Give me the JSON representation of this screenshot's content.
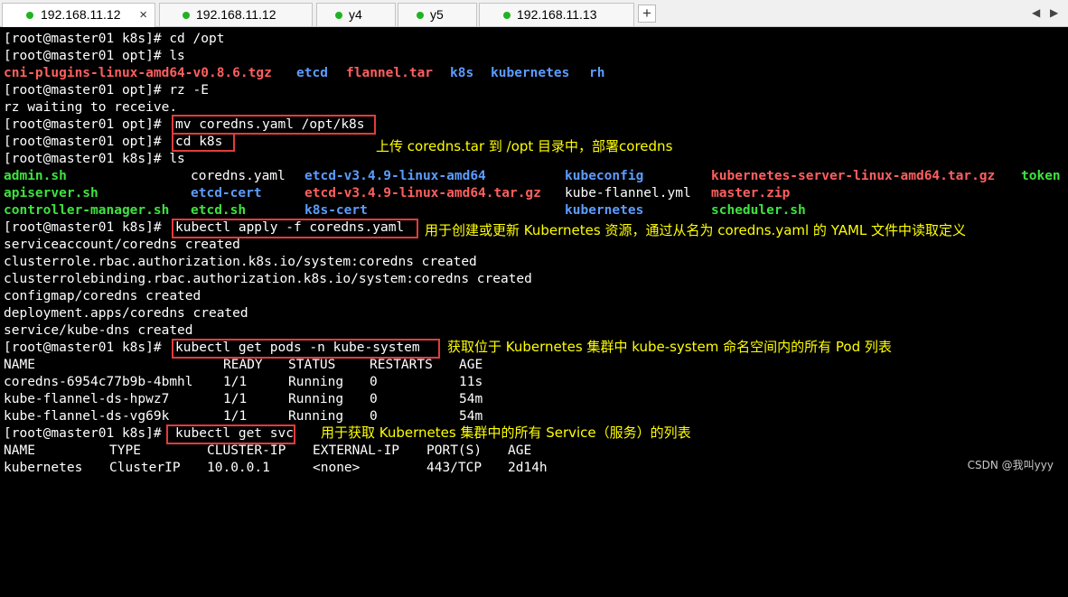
{
  "tabs": [
    {
      "label": "192.168.11.12",
      "active": true
    },
    {
      "label": "192.168.11.12",
      "active": false
    },
    {
      "label": "y4",
      "active": false
    },
    {
      "label": "y5",
      "active": false
    },
    {
      "label": "192.168.11.13",
      "active": false
    }
  ],
  "tabbar": {
    "close": "×",
    "add": "+",
    "prev": "◀",
    "next": "▶"
  },
  "terminal": {
    "l1": "[root@master01 k8s]# cd /opt",
    "l2": "[root@master01 opt]# ls",
    "l3": {
      "a": "cni-plugins-linux-amd64-v0.8.6.tgz",
      "b": "etcd",
      "c": "flannel.tar",
      "d": "k8s",
      "e": "kubernetes",
      "f": "rh"
    },
    "l4": "[root@master01 opt]# rz -E",
    "l5": "rz waiting to receive.",
    "l6": {
      "prompt": "[root@master01 opt]# ",
      "cmd": "mv coredns.yaml /opt/k8s"
    },
    "l7": {
      "prompt": "[root@master01 opt]# ",
      "cmd": "cd k8s"
    },
    "l8": "[root@master01 k8s]# ls",
    "ls": [
      [
        "admin.sh",
        "coredns.yaml",
        "etcd-v3.4.9-linux-amd64",
        "kubeconfig",
        "kubernetes-server-linux-amd64.tar.gz",
        "token"
      ],
      [
        "apiserver.sh",
        "etcd-cert",
        "etcd-v3.4.9-linux-amd64.tar.gz",
        "kube-flannel.yml",
        "master.zip"
      ],
      [
        "controller-manager.sh",
        "etcd.sh",
        "k8s-cert",
        "kubernetes",
        "scheduler.sh"
      ]
    ],
    "l12": {
      "prompt": "[root@master01 k8s]# ",
      "cmd": "kubectl apply -f coredns.yaml"
    },
    "created": [
      "serviceaccount/coredns created",
      "clusterrole.rbac.authorization.k8s.io/system:coredns created",
      "clusterrolebinding.rbac.authorization.k8s.io/system:coredns created",
      "configmap/coredns created",
      "deployment.apps/coredns created",
      "service/kube-dns created"
    ],
    "l19": {
      "prompt": "[root@master01 k8s]# ",
      "cmd": "kubectl get pods -n kube-system"
    },
    "pods": {
      "headers": [
        "NAME",
        "READY",
        "STATUS",
        "RESTARTS",
        "AGE"
      ],
      "rows": [
        [
          "coredns-6954c77b9b-4bmhl",
          "1/1",
          "Running",
          "0",
          "11s"
        ],
        [
          "kube-flannel-ds-hpwz7",
          "1/1",
          "Running",
          "0",
          "54m"
        ],
        [
          "kube-flannel-ds-vg69k",
          "1/1",
          "Running",
          "0",
          "54m"
        ]
      ]
    },
    "l24": {
      "prompt": "[root@master01 k8s]# ",
      "cmd": "kubectl get svc"
    },
    "svc": {
      "headers": [
        "NAME",
        "TYPE",
        "CLUSTER-IP",
        "EXTERNAL-IP",
        "PORT(S)",
        "AGE"
      ],
      "rows": [
        [
          "kubernetes",
          "ClusterIP",
          "10.0.0.1",
          "<none>",
          "443/TCP",
          "2d14h"
        ]
      ]
    }
  },
  "annotations": {
    "upload": "上传 coredns.tar 到 /opt 目录中，部署coredns",
    "apply": "用于创建或更新 Kubernetes 资源，通过从名为 coredns.yaml 的 YAML 文件中读取定义",
    "pods": "获取位于 Kubernetes 集群中 kube-system 命名空间内的所有 Pod 列表",
    "svc": "用于获取 Kubernetes 集群中的所有 Service（服务）的列表"
  },
  "watermark": "CSDN @我叫yyy",
  "colors": {
    "highlight_box": "#e33b3b",
    "annotation": "#ffff00",
    "archive": "#ff5f5f",
    "directory": "#5c9cff",
    "executable": "#3fe23f"
  }
}
